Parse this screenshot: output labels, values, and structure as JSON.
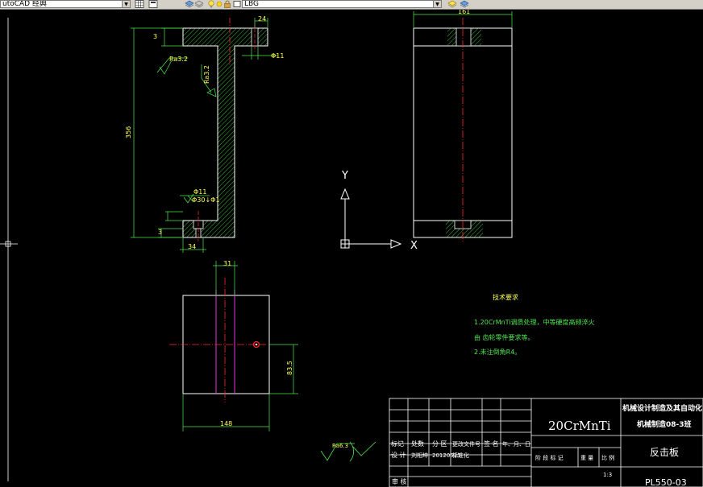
{
  "toolbar": {
    "style_combo_value": "utoCAD 经典",
    "layer_combo_value": "LBG",
    "icons": [
      "layers-icon",
      "layer-state-icon",
      "layer-prev-icon",
      "bulb-icon",
      "sun-icon",
      "lock-icon",
      "color-square-icon",
      "layer-tools-icon",
      "match-layer-icon"
    ]
  },
  "colors": {
    "background": "#000000",
    "outline": "#ffffff",
    "hatch": "#4fe84f",
    "dimension": "#4fe84f",
    "centerline": "#ff2a2a",
    "magenta": "#ff3cff",
    "text_green": "#4fe84f",
    "text_yellow": "#ffff55",
    "text_white": "#ffffff"
  },
  "dimensions": {
    "top_flange_width": "24",
    "flange_thickness": "3",
    "hole_dia": "Φ11",
    "total_height": "356",
    "rough1": "Ra3.2",
    "rough2": "Ra3.2",
    "counterbore": "Φ30↓Φ1",
    "bottom_hole_dia": "Φ11",
    "bottom_dim": "3",
    "bottom_width": "34",
    "side_view_width": "161",
    "plan_dim_top": "31",
    "plan_dim_right": "83.5",
    "plan_dim_bottom": "148"
  },
  "ucs": {
    "y_label": "Y",
    "x_label": "X"
  },
  "notes": {
    "title": "技术要求",
    "line1": "1.20CrMnTi调质处理，中等硬度高频淬火",
    "line2": "由  齿轮零件要求等。",
    "line3": "2.未注倒角R4。"
  },
  "surface_finish": "Ra6.3",
  "title_block": {
    "material": "20CrMnTi",
    "institute_line1": "机械设计制造及其自动化",
    "institute_line2": "机械制造08-3班",
    "part_name": "反击板",
    "drawing_no": "PL550-03",
    "scale": "1:3",
    "rev_headers": [
      "标记",
      "处数",
      "分 区",
      "更改文件号",
      "签 名",
      "年、月、日"
    ],
    "design_row": [
      "设 计",
      "刘相坤",
      "20120525",
      "标准化"
    ],
    "stage_headers": [
      "阶 段 标 记",
      "重 量",
      "比 例"
    ],
    "review": "审 核"
  }
}
